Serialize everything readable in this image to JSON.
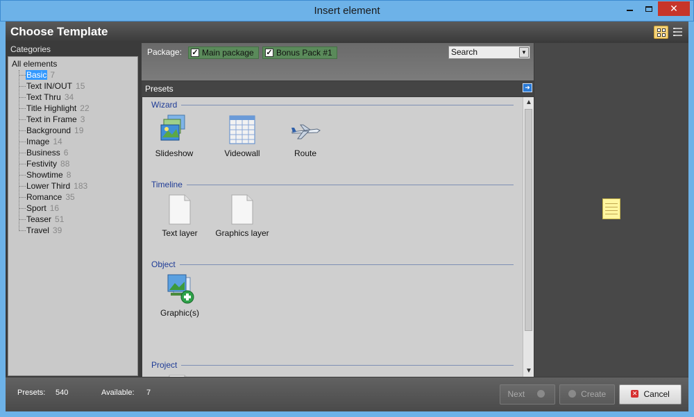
{
  "window": {
    "title": "Insert element"
  },
  "header": {
    "title": "Choose Template"
  },
  "categories": {
    "heading": "Categories",
    "root": "All elements",
    "items": [
      {
        "label": "Basic",
        "count": "7",
        "selected": true
      },
      {
        "label": "Text IN/OUT",
        "count": "15"
      },
      {
        "label": "Text Thru",
        "count": "34"
      },
      {
        "label": "Title Highlight",
        "count": "22"
      },
      {
        "label": "Text in Frame",
        "count": "3"
      },
      {
        "label": "Background",
        "count": "19"
      },
      {
        "label": "Image",
        "count": "14"
      },
      {
        "label": "Business",
        "count": "6"
      },
      {
        "label": "Festivity",
        "count": "88"
      },
      {
        "label": "Showtime",
        "count": "8"
      },
      {
        "label": "Lower Third",
        "count": "183"
      },
      {
        "label": "Romance",
        "count": "35"
      },
      {
        "label": "Sport",
        "count": "16"
      },
      {
        "label": "Teaser",
        "count": "51"
      },
      {
        "label": "Travel",
        "count": "39"
      }
    ]
  },
  "package": {
    "label": "Package:",
    "options": [
      {
        "label": "Main package",
        "checked": true
      },
      {
        "label": "Bonus Pack #1",
        "checked": true
      }
    ],
    "search_value": "Search"
  },
  "presets": {
    "heading": "Presets",
    "groups": {
      "wizard": {
        "title": "Wizard",
        "items": [
          "Slideshow",
          "Videowall",
          "Route"
        ]
      },
      "timeline": {
        "title": "Timeline",
        "items": [
          "Text layer",
          "Graphics layer"
        ]
      },
      "object": {
        "title": "Object",
        "items": [
          "Graphic(s)"
        ]
      },
      "project": {
        "title": "Project"
      }
    }
  },
  "footer": {
    "presets_label": "Presets:",
    "presets_value": "540",
    "available_label": "Available:",
    "available_value": "7",
    "next_label": "Next",
    "create_label": "Create",
    "cancel_label": "Cancel"
  },
  "colors": {
    "accent_selection": "#3399ff",
    "group_title": "#1e3b96",
    "package_chip": "#5a8a5a",
    "cancel_icon": "#d63030",
    "window_frame": "#6db2e8"
  }
}
